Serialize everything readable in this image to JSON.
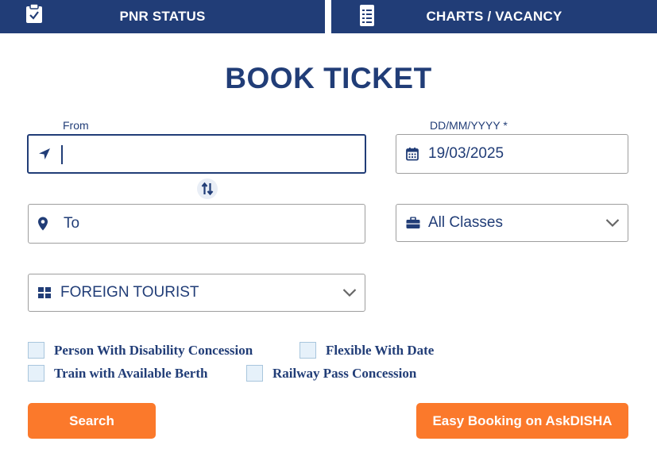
{
  "tabs": {
    "pnr_status": "PNR STATUS",
    "charts_vacancy": "CHARTS / VACANCY"
  },
  "title": "BOOK TICKET",
  "form": {
    "from_label": "From",
    "from_value": "",
    "date_label": "DD/MM/YYYY *",
    "date_value": "19/03/2025",
    "to_placeholder": "To",
    "class_value": "All Classes",
    "quota_value": "FOREIGN TOURIST"
  },
  "options": {
    "disability": "Person With Disability Concession",
    "flexible_date": "Flexible With Date",
    "available_berth": "Train with Available Berth",
    "railway_pass": "Railway Pass Concession"
  },
  "buttons": {
    "search": "Search",
    "askdisha": "Easy Booking on AskDISHA"
  },
  "colors": {
    "navy": "#213d77",
    "orange": "#fb792b"
  }
}
